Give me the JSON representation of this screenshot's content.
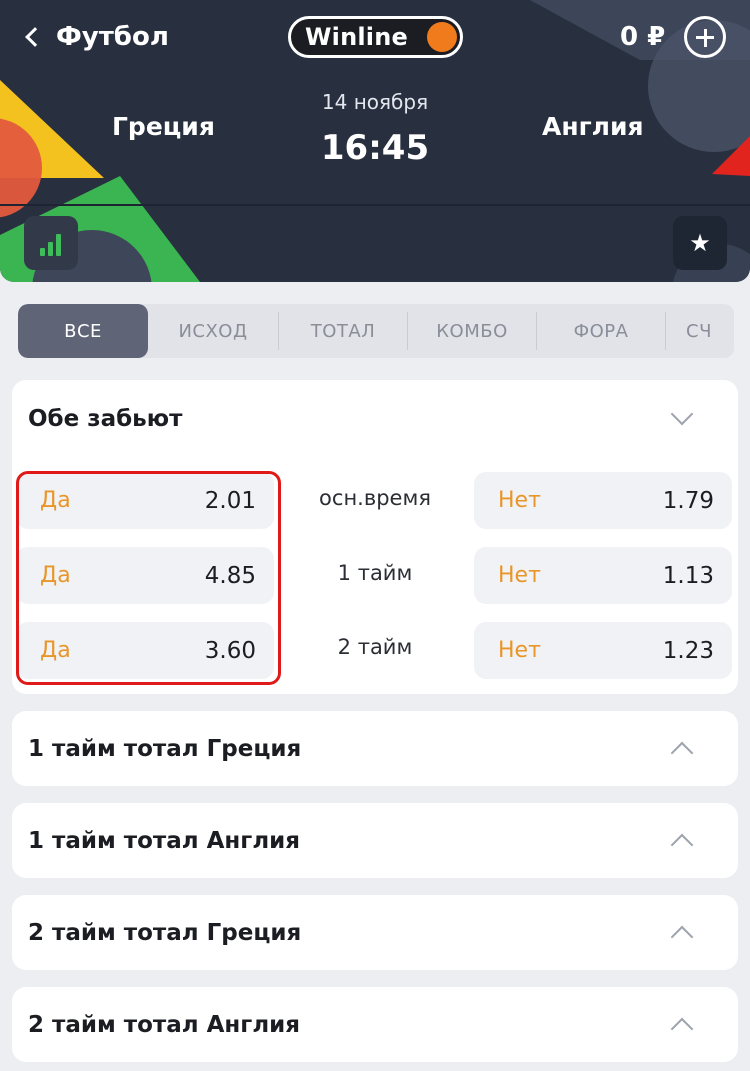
{
  "header": {
    "back_label": "Футбол",
    "logo_text": "Winline",
    "balance": "0 ₽",
    "home_team": "Греция",
    "away_team": "Англия",
    "date": "14 ноября",
    "time": "16:45",
    "star_glyph": "★"
  },
  "tabs": [
    {
      "label": "ВСЕ",
      "active": true
    },
    {
      "label": "ИСХОД"
    },
    {
      "label": "ТОТАЛ"
    },
    {
      "label": "КОМБО"
    },
    {
      "label": "ФОРА"
    },
    {
      "label": "СЧ"
    }
  ],
  "markets": {
    "both_score": {
      "title": "Обе забьют",
      "rows": [
        {
          "period": "осн.время",
          "yes_label": "Да",
          "yes_odds": "2.01",
          "no_label": "Нет",
          "no_odds": "1.79"
        },
        {
          "period": "1 тайм",
          "yes_label": "Да",
          "yes_odds": "4.85",
          "no_label": "Нет",
          "no_odds": "1.13"
        },
        {
          "period": "2 тайм",
          "yes_label": "Да",
          "yes_odds": "3.60",
          "no_label": "Нет",
          "no_odds": "1.23"
        }
      ]
    },
    "collapsed": [
      {
        "title": "1 тайм  тотал  Греция"
      },
      {
        "title": "1 тайм  тотал  Англия"
      },
      {
        "title": "2 тайм  тотал  Греция"
      },
      {
        "title": "2 тайм  тотал  Англия"
      }
    ]
  },
  "colors": {
    "header_bg": "#28303f",
    "accent_orange": "#f07b1d",
    "odds_label": "#e8962a",
    "highlight_red": "#e01919",
    "stats_green": "#3fbd5a"
  }
}
